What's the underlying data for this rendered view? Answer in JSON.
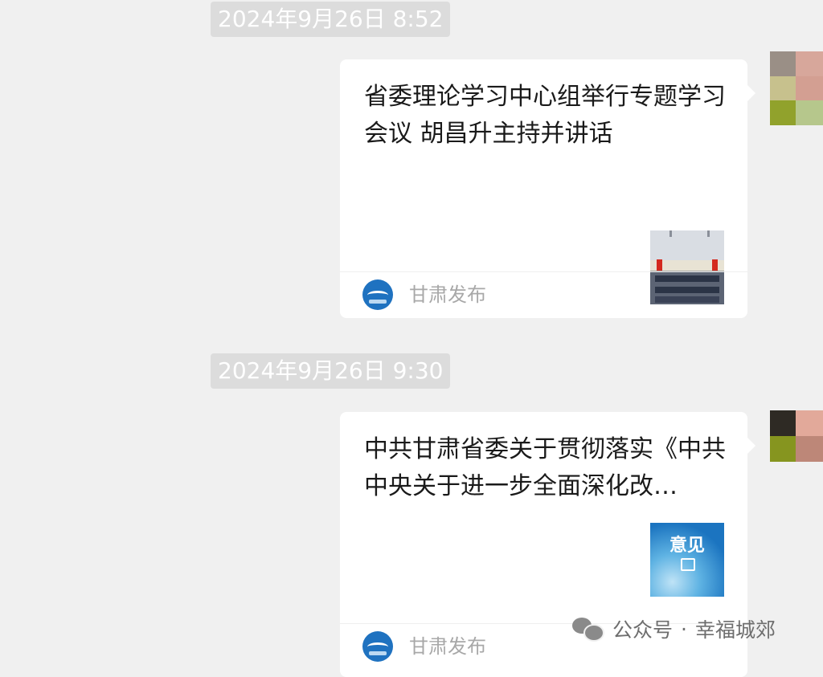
{
  "messages": [
    {
      "timestamp": "2024年9月26日 8:52",
      "title": "省委理论学习中心组举行专题学习会议 胡昌升主持并讲话",
      "thumbnail": "meeting-photo",
      "source": "甘肃发布",
      "avatar_colors": [
        "#9a8f86",
        "#d7a79b",
        "#c7c18d",
        "#d39f92",
        "#91a22c",
        "#b6c78c"
      ]
    },
    {
      "timestamp": "2024年9月26日 9:30",
      "title": "中共甘肃省委关于贯彻落实《中共中央关于进一步全面深化改…",
      "thumbnail": "opinion-cover",
      "thumbnail_text": "意见",
      "source": "甘肃发布",
      "avatar_colors": [
        "#2e2a24",
        "#e2a99a",
        "#86951f",
        "#bd8778"
      ]
    }
  ],
  "watermark": {
    "icon": "wechat-icon",
    "platform": "公众号",
    "separator": "·",
    "account": "幸福城郊"
  },
  "colors": {
    "background": "#f0f0f0",
    "card": "#ffffff",
    "timestamp_bg": "#dcdcdc",
    "source_icon": "#1f72c0"
  }
}
